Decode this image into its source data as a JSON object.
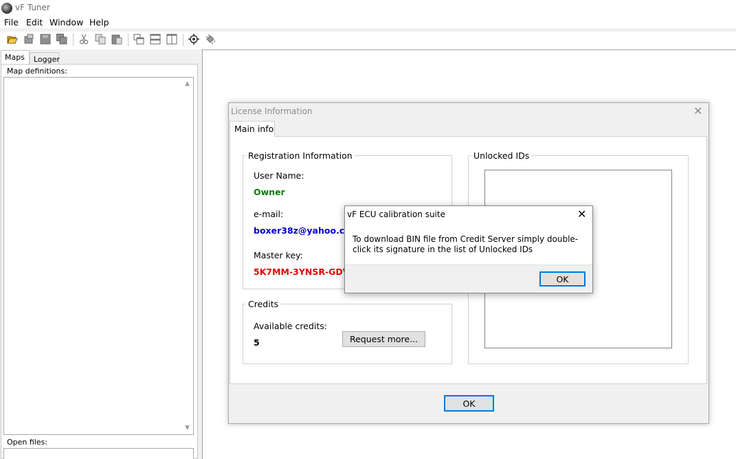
{
  "app": {
    "title": "vF Tuner"
  },
  "menu": [
    "File",
    "Edit",
    "Window",
    "Help"
  ],
  "toolbar": {
    "icons": [
      "open-folder-icon",
      "properties-icon",
      "save-icon",
      "save-all-icon",
      "cut-icon",
      "copy-icon",
      "paste-icon",
      "cascade-icon",
      "tile-horizontal-icon",
      "tile-vertical-icon",
      "target-icon",
      "chip-icon"
    ]
  },
  "left_panel": {
    "tabs": [
      "Maps",
      "Logger"
    ],
    "map_definitions_label": "Map definitions:",
    "open_files_label": "Open files:"
  },
  "license_dialog": {
    "title": "License Information",
    "tab_main": "Main info",
    "registration": {
      "title": "Registration Information",
      "user_name_label": "User Name:",
      "user_name": "Owner",
      "email_label": "e-mail:",
      "email": "boxer38z@yahoo.com",
      "master_key_label": "Master key:",
      "master_key": "5K7MM-3YNSR-GDVL"
    },
    "credits": {
      "title": "Credits",
      "available_label": "Available credits:",
      "available": "5",
      "request_button": "Request more..."
    },
    "unlocked_title": "Unlocked IDs",
    "ok_button": "OK"
  },
  "message_box": {
    "title": "vF ECU calibration suite",
    "text": "To download BIN file from Credit Server simply double-click its signature in the list of Unlocked IDs",
    "ok_button": "OK"
  }
}
